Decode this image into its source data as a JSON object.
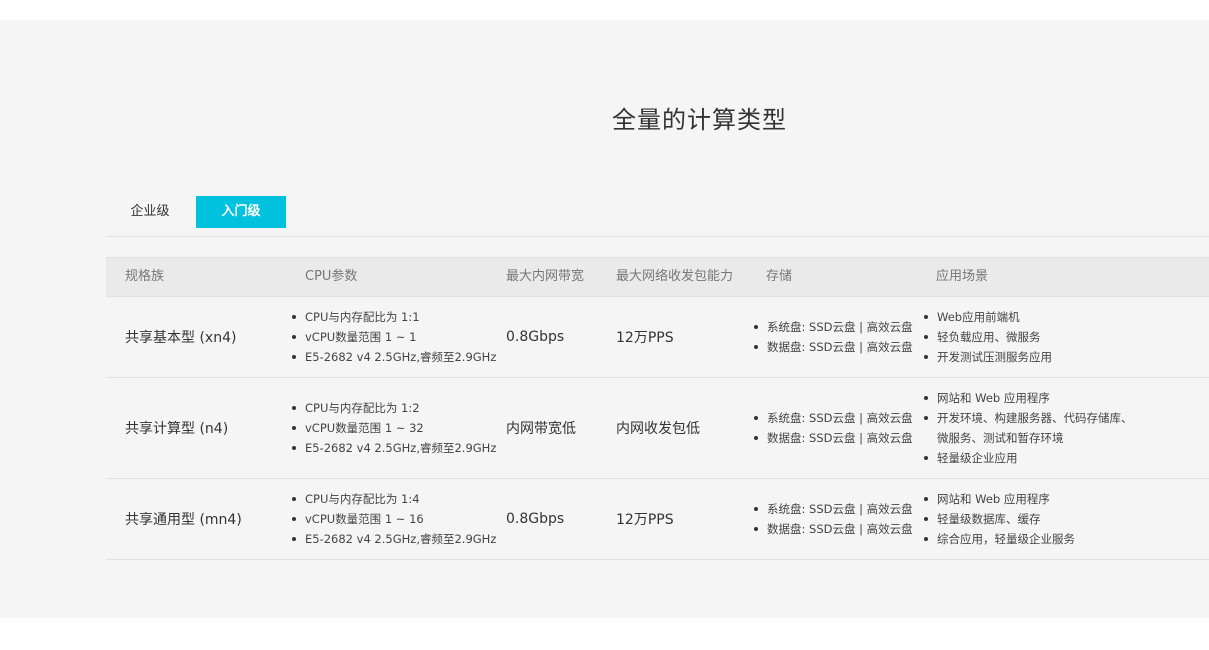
{
  "title": "全量的计算类型",
  "tabs": [
    {
      "label": "企业级",
      "active": false
    },
    {
      "label": "入门级",
      "active": true
    }
  ],
  "accent_color": "#00c1de",
  "table": {
    "headers": [
      "规格族",
      "CPU参数",
      "最大内网带宽",
      "最大网络收发包能力",
      "存储",
      "应用场景"
    ],
    "rows": [
      {
        "name": "共享基本型 (xn4)",
        "cpu": [
          "CPU与内存配比为 1:1",
          "vCPU数量范围 1 ~ 1",
          "E5-2682 v4 2.5GHz,睿频至2.9GHz"
        ],
        "bandwidth": "0.8Gbps",
        "pps": "12万PPS",
        "storage": [
          "系统盘: SSD云盘 | 高效云盘",
          "数据盘: SSD云盘 | 高效云盘"
        ],
        "scenarios": [
          "Web应用前端机",
          "轻负载应用、微服务",
          "开发测试压测服务应用"
        ]
      },
      {
        "name": "共享计算型 (n4)",
        "cpu": [
          "CPU与内存配比为 1:2",
          "vCPU数量范围 1 ~ 32",
          "E5-2682 v4 2.5GHz,睿频至2.9GHz"
        ],
        "bandwidth": "内网带宽低",
        "pps": "内网收发包低",
        "storage": [
          "系统盘: SSD云盘 | 高效云盘",
          "数据盘: SSD云盘 | 高效云盘"
        ],
        "scenarios": [
          "网站和 Web 应用程序",
          "开发环境、构建服务器、代码存储库、",
          "微服务、测试和暂存环境",
          "轻量级企业应用"
        ]
      },
      {
        "name": "共享通用型 (mn4)",
        "cpu": [
          "CPU与内存配比为 1:4",
          "vCPU数量范围 1 ~ 16",
          "E5-2682 v4 2.5GHz,睿频至2.9GHz"
        ],
        "bandwidth": "0.8Gbps",
        "pps": "12万PPS",
        "storage": [
          "系统盘: SSD云盘 | 高效云盘",
          "数据盘: SSD云盘 | 高效云盘"
        ],
        "scenarios": [
          "网站和 Web 应用程序",
          "轻量级数据库、缓存",
          "综合应用，轻量级企业服务"
        ]
      }
    ]
  }
}
